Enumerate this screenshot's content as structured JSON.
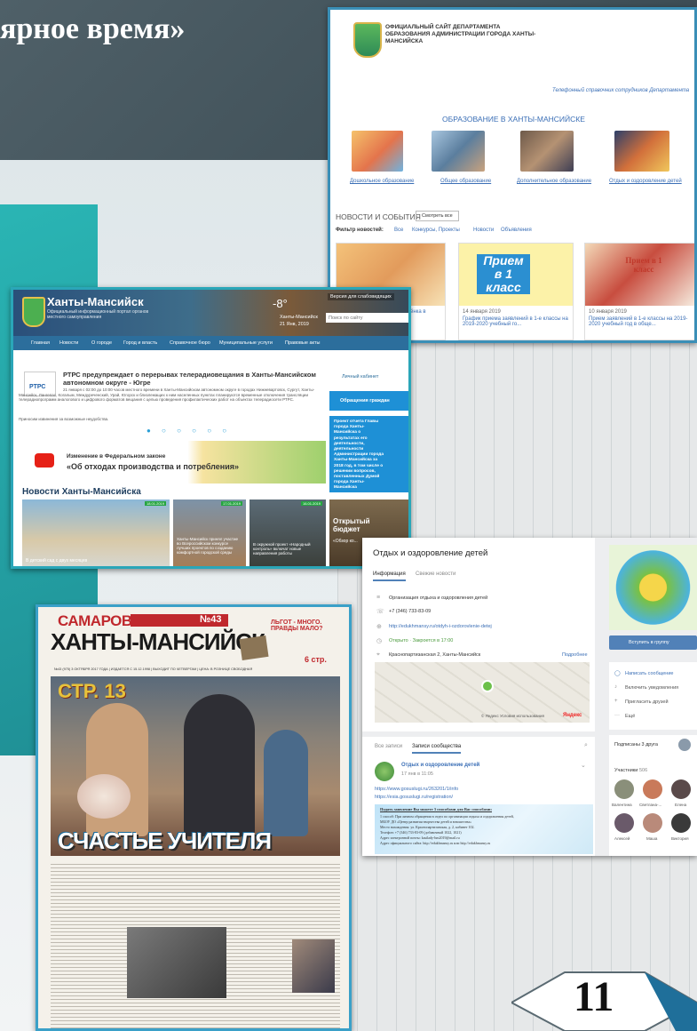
{
  "slide": {
    "title": "ярное время»",
    "page_number": "11"
  },
  "site1": {
    "header": "ОФИЦИАЛЬНЫЙ САЙТ ДЕПАРТАМЕНТА ОБРАЗОВАНИЯ АДМИНИСТРАЦИИ ГОРОДА ХАНТЫ-МАНСИЙСКА",
    "header_l1": "ОФИЦИАЛЬНЫЙ САЙТ ДЕПАРТАМЕНТА",
    "header_l2": "ОБРАЗОВАНИЯ АДМИНИСТРАЦИИ ГОРОДА ХАНТЫ-",
    "header_l3": "МАНСИЙСКА",
    "phone_link": "Телефонный справочник сотрудников Департамента",
    "section_title": "ОБРАЗОВАНИЕ В ХАНТЫ-МАНСИЙСКЕ",
    "categories": [
      "Дошкольное образование",
      "Общее образование",
      "Дополнительное образование",
      "Отдых и оздоровление детей"
    ],
    "news_title": "НОВОСТИ И СОБЫТИЯ",
    "see_all": "Смотреть все",
    "filter_label": "Фильтр новостей:",
    "filters": [
      "Все",
      "Конкурсы, Проекты",
      "Новости",
      "Объявления"
    ],
    "news_cards": [
      {
        "date": "",
        "text": "...ёнка в"
      },
      {
        "date": "14 января 2019",
        "text": "График приема заявлений в 1-е классы на 2019-2020 учебный го...",
        "img_text": "Прием в 1 класс"
      },
      {
        "date": "10 января 2019",
        "text": "Прием заявлений в 1-е классы на 2019-2020 учебный год в обще...",
        "img_text": "Прием в 1 класс"
      }
    ]
  },
  "site2": {
    "logo_title": "Ханты-Мансийск",
    "logo_sub": "Официальный информационный портал органов местного самоуправления",
    "temperature": "-8°",
    "city_label": "Ханты-Мансийск",
    "date": "21 Янв, 2019",
    "accessibility": "Версия для слабовидящих",
    "search_placeholder": "Поиск по сайту",
    "nav": [
      "Главная",
      "Новости",
      "О городе",
      "Город и власть",
      "Справочное бюро",
      "Муниципальные услуги",
      "Правовые акты"
    ],
    "news_head": "РТРС предупреждает о перерывах телерадиовещания в Ханты-Мансийском автономном округе - Югре",
    "rtrs": "РТРС",
    "news_body": "21 января с 02:00 до 10:00 часов местного времени в Ханты-Мансийском автономном округе в городах Нижневартовск, Сургут, Ханты-Мансийск, Лангепас, Когалым, Междуреченский, Урай, Югорск и близлежащих к ним населенных пунктах планируются временные отключения трансляции телерадиопрограмм аналогового и цифрового форматов вещания с целью проведения профилактических работ на объектах телерадиосети РТРС.",
    "news_apology": "Приносим извинения за возможные неудобства.",
    "banner_l1": "Изменение в Федеральном законе",
    "banner_l2": "«Об отходах производства и потребления»",
    "sidebar": [
      "Личный кабинет",
      "Обращения граждан"
    ],
    "project_text": "Проект отчета Главы города Ханты-Мансийска о результатах его деятельности, деятельности Администрации города Ханты-Мансийска за 2018 год, в том числе о решении вопросов, поставленных Думой города Ханты-Мансийска",
    "city_news": "Новости Ханты-Мансийска",
    "news_tiles": [
      {
        "date": "18.01.2019",
        "text": "В детский сад с двух месяцев"
      },
      {
        "date": "17.01.2019",
        "text": "Ханты-Мансийск принял участие во Всероссийском конкурсе лучших проектов по созданию комфортной городской среды"
      },
      {
        "date": "16.01.2019",
        "text": "В окружной проект «Народный контроль» включат новые направления работы"
      }
    ],
    "open_budget": "Открытый бюджет",
    "open_budget_sub": "«Обзор ко..."
  },
  "vk": {
    "title": "Отдых и оздоровление детей",
    "tabs": [
      "Информация",
      "Свежие новости"
    ],
    "info": [
      {
        "icon": "description-icon",
        "text": "Организация отдыха и оздоровления детей"
      },
      {
        "icon": "phone-icon",
        "text": "+7 (346) 733-83-09"
      },
      {
        "icon": "globe-icon",
        "text": "http://edukhmansy.ru/otdyh-i-ozdorovlenie-detej"
      },
      {
        "icon": "clock-icon",
        "text": "Открыто · Закроется в 17:00"
      },
      {
        "icon": "location-icon",
        "text": "Краснопартизанская 2, Ханты-Мансийск"
      }
    ],
    "details_link": "Подробнее",
    "map_footer": "© Яндекс  Условия использования",
    "yandex": "Яндекс",
    "join": "Вступить в группу",
    "side_links": [
      "Написать сообщение",
      "Включить уведомления",
      "Пригласить друзей",
      "Ещё"
    ],
    "subs": "Подписаны 3 друга",
    "members_label": "Участники",
    "members_count": "506",
    "members": [
      "Валентина",
      "Светлана-...",
      "Елена",
      "Алексей",
      "Маша",
      "Виктория"
    ],
    "wall_tabs": [
      "Все записи",
      "Записи сообщества"
    ],
    "post_author": "Отдых и оздоровление детей",
    "post_time": "17 янв в 11:05",
    "post_links": [
      "https://www.gosuslugi.ru/263201/1/info",
      "https://esia.gosuslugi.ru/registration/"
    ],
    "post_box_title": "Подать заявление Вы можете 3 способами для Вас способами:",
    "post_box_lines": [
      "1 способ: При личном обращении в отдел по организации отдыха и оздоровления детей,",
      "МБОУ ДО «Центр развития творчества детей и юношества»",
      "Место нахождения: ул. Краснопартизанская, д. 2, кабинет 102.",
      "Телефон: +7 (346) 733-83-09 (добавочный 1022, 1021)",
      "Адрес электронной почты: kasilady-hm2019@mail.ru",
      "Адрес официального сайта: http://edukhmansy.ru или http://edukhmansy.ru"
    ]
  },
  "newspaper": {
    "masthead_top": "САМАРОВО",
    "masthead": "ХАНТЫ-МАНСИЙСК",
    "issue": "№43",
    "teaser": "ЛЬГОТ - МНОГО. ПРАВДЫ МАЛО?",
    "teaser_page": "6 стр.",
    "info_line": "№43 (975) 3 ОКТЯБРЯ 2017 ГОДА | ИЗДАЕТСЯ С 15.12.1998 | ВЫХОДИТ ПО ЧЕТВЕРГАМ | ЦЕНА: В РОЗНИЦЕ СВОБОДНАЯ",
    "page_ref": "СТР. 13",
    "headline": "СЧАСТЬЕ УЧИТЕЛЯ"
  }
}
